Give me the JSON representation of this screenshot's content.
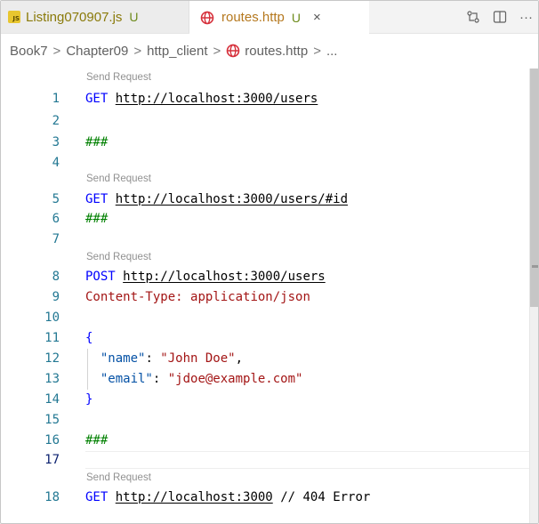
{
  "tabs": [
    {
      "label": "Listing070907.js",
      "status": "U",
      "icon": "js-file-icon"
    },
    {
      "label": "routes.http",
      "status": "U",
      "icon": "globe-icon",
      "close": "×"
    }
  ],
  "tab_actions": [
    "compare-changes-icon",
    "split-editor-icon",
    "more-actions-icon"
  ],
  "more_glyph": "···",
  "breadcrumb": {
    "items": [
      "Book7",
      "Chapter09",
      "http_client",
      "routes.http",
      "..."
    ],
    "separator": ">"
  },
  "codelens_label": "Send Request",
  "lines": {
    "l1": "1",
    "l2": "2",
    "l3": "3",
    "l4": "4",
    "l5": "5",
    "l6": "6",
    "l7": "7",
    "l8": "8",
    "l9": "9",
    "l10": "10",
    "l11": "11",
    "l12": "12",
    "l13": "13",
    "l14": "14",
    "l15": "15",
    "l16": "16",
    "l17": "17",
    "l18": "18"
  },
  "code": {
    "get": "GET",
    "post": "POST",
    "url_users": "http://localhost:3000/users",
    "url_user_id": "http://localhost:3000/users/#id",
    "url_root": "http://localhost:3000",
    "separator": "###",
    "content_type_key": "Content-Type:",
    "content_type_val": "application/json",
    "brace_open": "{",
    "brace_close": "}",
    "name_key": "\"name\"",
    "name_val": "\"John Doe\"",
    "email_key": "\"email\"",
    "email_val": "\"jdoe@example.com\"",
    "colon": ": ",
    "comma": ",",
    "comment": "// 404 Error"
  },
  "colors": {
    "keyword": "#0000ff",
    "string": "#a31515",
    "json_key": "#0451a5",
    "line_number": "#237893",
    "untracked": "#6d8b1c"
  }
}
